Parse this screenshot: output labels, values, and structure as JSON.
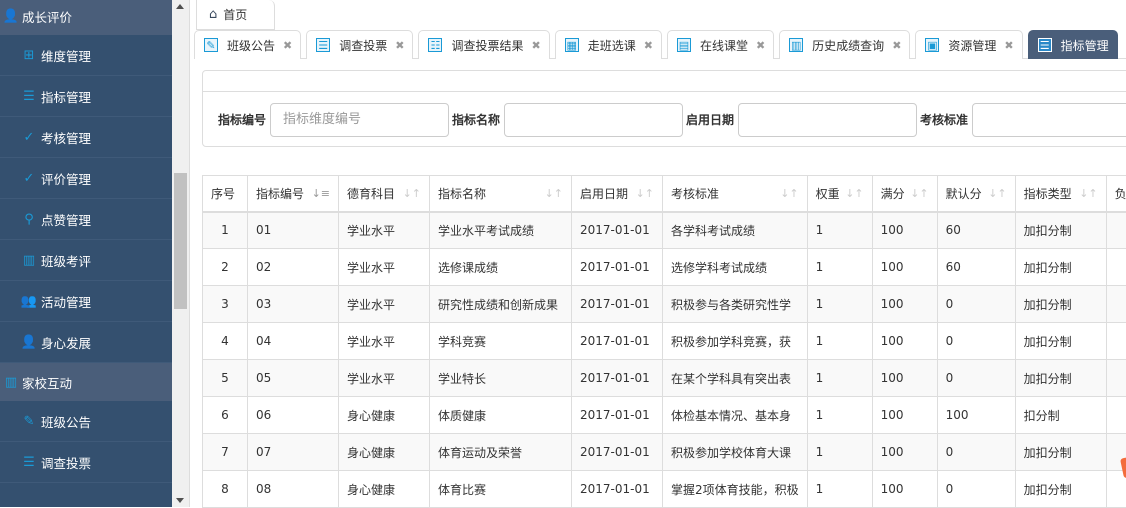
{
  "sidebar": {
    "groups": [
      {
        "label": "成长评价",
        "icon": "user-badge-icon",
        "items": [
          {
            "label": "维度管理",
            "icon": "sitemap-icon"
          },
          {
            "label": "指标管理",
            "icon": "list-icon"
          },
          {
            "label": "考核管理",
            "icon": "check-icon"
          },
          {
            "label": "评价管理",
            "icon": "check-icon"
          },
          {
            "label": "点赞管理",
            "icon": "map-pin-icon"
          },
          {
            "label": "班级考评",
            "icon": "bar-chart-icon"
          },
          {
            "label": "活动管理",
            "icon": "users-icon"
          },
          {
            "label": "身心发展",
            "icon": "user-badge-icon"
          }
        ]
      },
      {
        "label": "家校互动",
        "icon": "bar-chart-icon",
        "items": [
          {
            "label": "班级公告",
            "icon": "edit-icon"
          },
          {
            "label": "调查投票",
            "icon": "list-icon"
          }
        ]
      }
    ]
  },
  "home_tab": {
    "label": "首页"
  },
  "tabs": [
    {
      "label": "班级公告",
      "icon": "edit-icon",
      "glyph": "✎"
    },
    {
      "label": "调查投票",
      "icon": "list-icon",
      "glyph": "☰"
    },
    {
      "label": "调查投票结果",
      "icon": "list-check-icon",
      "glyph": "☷"
    },
    {
      "label": "走班选课",
      "icon": "grid-icon",
      "glyph": "▦"
    },
    {
      "label": "在线课堂",
      "icon": "database-icon",
      "glyph": "▤"
    },
    {
      "label": "历史成绩查询",
      "icon": "bar-chart-icon",
      "glyph": "▥"
    },
    {
      "label": "资源管理",
      "icon": "sitemap-icon",
      "glyph": "▣"
    },
    {
      "label": "指标管理",
      "icon": "list-icon",
      "glyph": "☰",
      "active": true
    }
  ],
  "search": {
    "fields": [
      {
        "label": "指标编号",
        "placeholder": "指标维度编号",
        "value": ""
      },
      {
        "label": "指标名称",
        "placeholder": "",
        "value": ""
      },
      {
        "label": "启用日期",
        "placeholder": "",
        "value": ""
      },
      {
        "label": "考核标准",
        "placeholder": "",
        "value": ""
      }
    ]
  },
  "table": {
    "columns": [
      "序号",
      "指标编号",
      "德育科目",
      "指标名称",
      "启用日期",
      "考核标准",
      "权重",
      "满分",
      "默认分",
      "指标类型",
      "负"
    ],
    "rows": [
      [
        "1",
        "01",
        "学业水平",
        "学业水平考试成绩",
        "2017-01-01",
        "各学科考试成绩",
        "1",
        "100",
        "60",
        "加扣分制",
        ""
      ],
      [
        "2",
        "02",
        "学业水平",
        "选修课成绩",
        "2017-01-01",
        "选修学科考试成绩",
        "1",
        "100",
        "60",
        "加扣分制",
        ""
      ],
      [
        "3",
        "03",
        "学业水平",
        "研究性成绩和创新成果",
        "2017-01-01",
        "积极参与各类研究性学",
        "1",
        "100",
        "0",
        "加扣分制",
        ""
      ],
      [
        "4",
        "04",
        "学业水平",
        "学科竞赛",
        "2017-01-01",
        "积极参加学科竞赛，获",
        "1",
        "100",
        "0",
        "加扣分制",
        ""
      ],
      [
        "5",
        "05",
        "学业水平",
        "学业特长",
        "2017-01-01",
        "在某个学科具有突出表",
        "1",
        "100",
        "0",
        "加扣分制",
        ""
      ],
      [
        "6",
        "06",
        "身心健康",
        "体质健康",
        "2017-01-01",
        "体检基本情况、基本身",
        "1",
        "100",
        "100",
        "扣分制",
        ""
      ],
      [
        "7",
        "07",
        "身心健康",
        "体育运动及荣誉",
        "2017-01-01",
        "积极参加学校体育大课",
        "1",
        "100",
        "0",
        "加扣分制",
        ""
      ],
      [
        "8",
        "08",
        "身心健康",
        "体育比赛",
        "2017-01-01",
        "掌握2项体育技能，积极",
        "1",
        "100",
        "0",
        "加扣分制",
        ""
      ]
    ]
  }
}
